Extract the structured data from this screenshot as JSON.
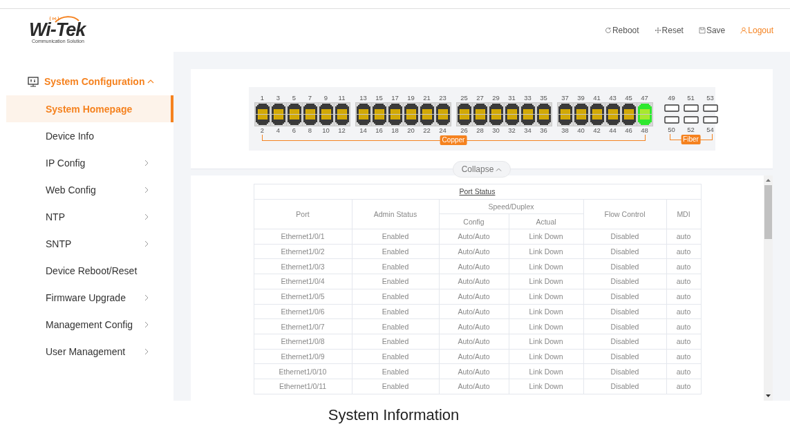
{
  "logo": {
    "brand": "Wi-Tek",
    "tagline": "Communication Solution"
  },
  "header_actions": [
    {
      "kind": "reboot",
      "label": "Reboot"
    },
    {
      "kind": "reset",
      "label": "Reset"
    },
    {
      "kind": "save",
      "label": "Save"
    },
    {
      "kind": "logout",
      "label": "Logout"
    }
  ],
  "sidebar": {
    "section": {
      "label": "System Configuration",
      "expanded": true
    },
    "items": [
      {
        "label": "System Homepage",
        "selected": true,
        "has_submenu": false
      },
      {
        "label": "Device Info",
        "selected": false,
        "has_submenu": false
      },
      {
        "label": "IP Config",
        "selected": false,
        "has_submenu": true
      },
      {
        "label": "Web Config",
        "selected": false,
        "has_submenu": true
      },
      {
        "label": "NTP",
        "selected": false,
        "has_submenu": true
      },
      {
        "label": "SNTP",
        "selected": false,
        "has_submenu": true
      },
      {
        "label": "Device Reboot/Reset",
        "selected": false,
        "has_submenu": false
      },
      {
        "label": "Firmware Upgrade",
        "selected": false,
        "has_submenu": true
      },
      {
        "label": "Management Config",
        "selected": false,
        "has_submenu": true
      },
      {
        "label": "User Management",
        "selected": false,
        "has_submenu": true
      }
    ]
  },
  "panel": {
    "copper_label": "Copper",
    "fiber_label": "Fiber",
    "copper_ports": [
      {
        "label": "1",
        "up": false
      },
      {
        "label": "2",
        "up": false
      },
      {
        "label": "3",
        "up": false
      },
      {
        "label": "4",
        "up": false
      },
      {
        "label": "5",
        "up": false
      },
      {
        "label": "6",
        "up": false
      },
      {
        "label": "7",
        "up": false
      },
      {
        "label": "8",
        "up": false
      },
      {
        "label": "9",
        "up": false
      },
      {
        "label": "10",
        "up": false
      },
      {
        "label": "11",
        "up": false
      },
      {
        "label": "12",
        "up": false
      },
      {
        "label": "13",
        "up": false
      },
      {
        "label": "14",
        "up": false
      },
      {
        "label": "15",
        "up": false
      },
      {
        "label": "16",
        "up": false
      },
      {
        "label": "17",
        "up": false
      },
      {
        "label": "18",
        "up": false
      },
      {
        "label": "19",
        "up": false
      },
      {
        "label": "20",
        "up": false
      },
      {
        "label": "21",
        "up": false
      },
      {
        "label": "22",
        "up": false
      },
      {
        "label": "23",
        "up": false
      },
      {
        "label": "24",
        "up": false
      },
      {
        "label": "25",
        "up": false
      },
      {
        "label": "26",
        "up": false
      },
      {
        "label": "27",
        "up": false
      },
      {
        "label": "28",
        "up": false
      },
      {
        "label": "29",
        "up": false
      },
      {
        "label": "30",
        "up": false
      },
      {
        "label": "31",
        "up": false
      },
      {
        "label": "32",
        "up": false
      },
      {
        "label": "33",
        "up": false
      },
      {
        "label": "34",
        "up": false
      },
      {
        "label": "35",
        "up": false
      },
      {
        "label": "36",
        "up": false
      },
      {
        "label": "37",
        "up": false
      },
      {
        "label": "38",
        "up": false
      },
      {
        "label": "39",
        "up": false
      },
      {
        "label": "40",
        "up": false
      },
      {
        "label": "41",
        "up": false
      },
      {
        "label": "42",
        "up": false
      },
      {
        "label": "43",
        "up": false
      },
      {
        "label": "44",
        "up": false
      },
      {
        "label": "45",
        "up": false
      },
      {
        "label": "46",
        "up": false
      },
      {
        "label": "47",
        "up": true
      },
      {
        "label": "48",
        "up": true
      }
    ],
    "fiber_ports": [
      {
        "label": "49",
        "up": false
      },
      {
        "label": "50",
        "up": false
      },
      {
        "label": "51",
        "up": false
      },
      {
        "label": "52",
        "up": false
      },
      {
        "label": "53",
        "up": false
      },
      {
        "label": "54",
        "up": false
      }
    ],
    "collapse_label": "Collapse"
  },
  "table": {
    "title": "Port Status",
    "columns": [
      {
        "label": "Port"
      },
      {
        "label": "Admin Status"
      },
      {
        "label": "Speed/Duplex",
        "colspan": 2,
        "children": [
          "Config",
          "Actual"
        ]
      },
      {
        "label": "Flow Control"
      },
      {
        "label": "MDI"
      }
    ],
    "rows": [
      [
        "Ethernet1/0/1",
        "Enabled",
        "Auto/Auto",
        "Link Down",
        "Disabled",
        "auto"
      ],
      [
        "Ethernet1/0/2",
        "Enabled",
        "Auto/Auto",
        "Link Down",
        "Disabled",
        "auto"
      ],
      [
        "Ethernet1/0/3",
        "Enabled",
        "Auto/Auto",
        "Link Down",
        "Disabled",
        "auto"
      ],
      [
        "Ethernet1/0/4",
        "Enabled",
        "Auto/Auto",
        "Link Down",
        "Disabled",
        "auto"
      ],
      [
        "Ethernet1/0/5",
        "Enabled",
        "Auto/Auto",
        "Link Down",
        "Disabled",
        "auto"
      ],
      [
        "Ethernet1/0/6",
        "Enabled",
        "Auto/Auto",
        "Link Down",
        "Disabled",
        "auto"
      ],
      [
        "Ethernet1/0/7",
        "Enabled",
        "Auto/Auto",
        "Link Down",
        "Disabled",
        "auto"
      ],
      [
        "Ethernet1/0/8",
        "Enabled",
        "Auto/Auto",
        "Link Down",
        "Disabled",
        "auto"
      ],
      [
        "Ethernet1/0/9",
        "Enabled",
        "Auto/Auto",
        "Link Down",
        "Disabled",
        "auto"
      ],
      [
        "Ethernet1/0/10",
        "Enabled",
        "Auto/Auto",
        "Link Down",
        "Disabled",
        "auto"
      ],
      [
        "Ethernet1/0/11",
        "Enabled",
        "Auto/Auto",
        "Link Down",
        "Disabled",
        "auto"
      ]
    ]
  },
  "caption": "System Information"
}
